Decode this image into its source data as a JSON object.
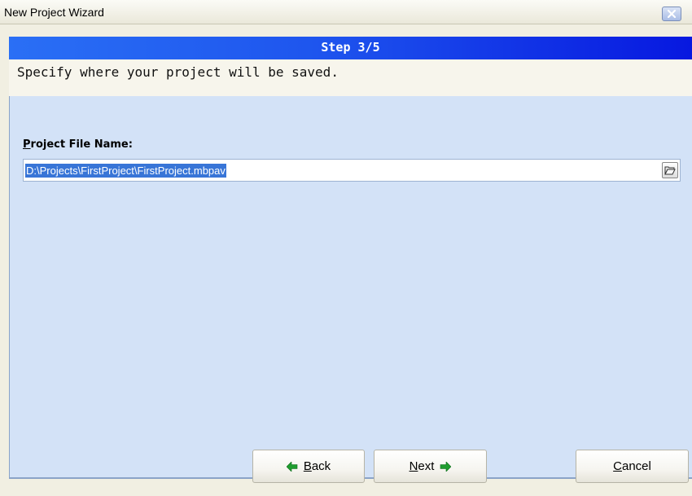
{
  "window": {
    "title": "New Project Wizard",
    "close_icon": "close-icon"
  },
  "wizard": {
    "step_label": "Step 3/5",
    "description": "Specify where your project will be saved."
  },
  "form": {
    "label_mnemonic": "P",
    "label_rest": "roject File Name:",
    "path_value": "D:\\Projects\\FirstProject\\FirstProject.mbpav",
    "browse_icon": "folder-open-icon"
  },
  "buttons": {
    "back_mnemonic": "B",
    "back_rest": "ack",
    "next_mnemonic": "N",
    "next_rest": "ext",
    "cancel_mnemonic": "C",
    "cancel_rest": "ancel",
    "arrow_color": "#1f9d2f"
  },
  "colors": {
    "banner_start": "#2a6ff5",
    "banner_end": "#0718e0",
    "panel_bg": "#d3e2f7",
    "selection_bg": "#3875d7"
  }
}
